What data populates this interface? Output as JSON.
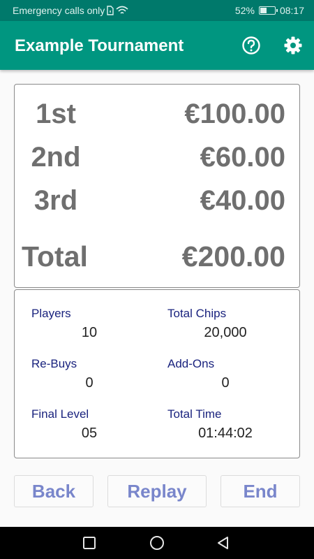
{
  "status_bar": {
    "carrier_text": "Emergency calls only",
    "battery_percent": "52%",
    "battery_level": 0.52,
    "time": "08:17",
    "icons": [
      "sim-icon",
      "wifi-icon",
      "battery-icon"
    ]
  },
  "app_bar": {
    "title": "Example Tournament",
    "icons": [
      "help-icon",
      "settings-gear-icon"
    ],
    "color": "#009680"
  },
  "payouts": {
    "rows": [
      {
        "place": "1st",
        "amount": "€100.00"
      },
      {
        "place": "2nd",
        "amount": "€60.00"
      },
      {
        "place": "3rd",
        "amount": "€40.00"
      }
    ],
    "total_label": "Total",
    "total_amount": "€200.00"
  },
  "stats": {
    "players": {
      "label": "Players",
      "value": "10"
    },
    "total_chips": {
      "label": "Total Chips",
      "value": "20,000"
    },
    "rebuys": {
      "label": "Re-Buys",
      "value": "0"
    },
    "addons": {
      "label": "Add-Ons",
      "value": "0"
    },
    "final_level": {
      "label": "Final Level",
      "value": "05"
    },
    "total_time": {
      "label": "Total Time",
      "value": "01:44:02"
    }
  },
  "buttons": {
    "back": "Back",
    "replay": "Replay",
    "end": "End"
  },
  "nav": {
    "icons": [
      "recents-square-icon",
      "home-circle-icon",
      "back-triangle-icon"
    ]
  }
}
